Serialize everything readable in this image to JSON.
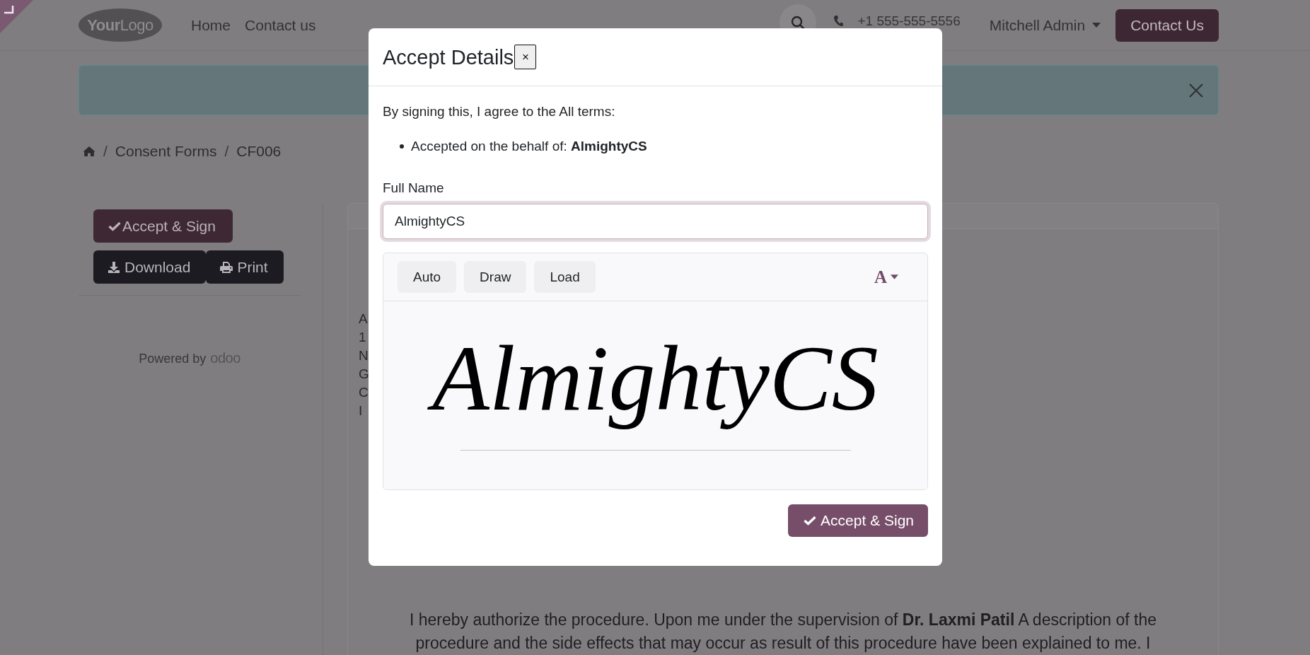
{
  "header": {
    "logo": "**Your**Logo",
    "nav": [
      {
        "label": "Home"
      },
      {
        "label": "Contact us"
      }
    ],
    "phone": "+1 555-555-5556",
    "user": "Mitchell Admin",
    "cta": "Contact Us"
  },
  "alert": {
    "closable": true
  },
  "breadcrumb": [
    {
      "separator": "/",
      "label": "Consent Forms"
    },
    {
      "separator": "/",
      "label": "CF006"
    }
  ],
  "sidebar": {
    "buttons": [
      {
        "label": "Accept & Sign",
        "kind": "sign"
      },
      {
        "label": "Download",
        "kind": "download"
      },
      {
        "label": "Print",
        "kind": "print"
      }
    ],
    "powered_by": "Powered by",
    "brand": "odoo"
  },
  "document": {
    "address_lines": [
      "A",
      "1",
      "N",
      "G",
      "C",
      "I"
    ],
    "paragraph": "I hereby authorize the procedure. Upon me under the supervision of **Dr. Laxmi Patil** A description of the procedure and the side effects that may occur as result of this procedure have been explained to me. I"
  },
  "modal": {
    "title": "Accept Details",
    "close": "×",
    "intro": "By signing this, I agree to the All terms:",
    "terms": [
      "Accepted on the behalf of: **AlmightyCS**"
    ],
    "name_field": {
      "label": "Full Name",
      "value": "AlmightyCS"
    },
    "signature": {
      "modes": [
        {
          "label": "Auto"
        },
        {
          "label": "Draw"
        },
        {
          "label": "Load"
        }
      ],
      "font_button": "A",
      "text": "AlmightyCS"
    },
    "submit": "Accept & Sign"
  }
}
